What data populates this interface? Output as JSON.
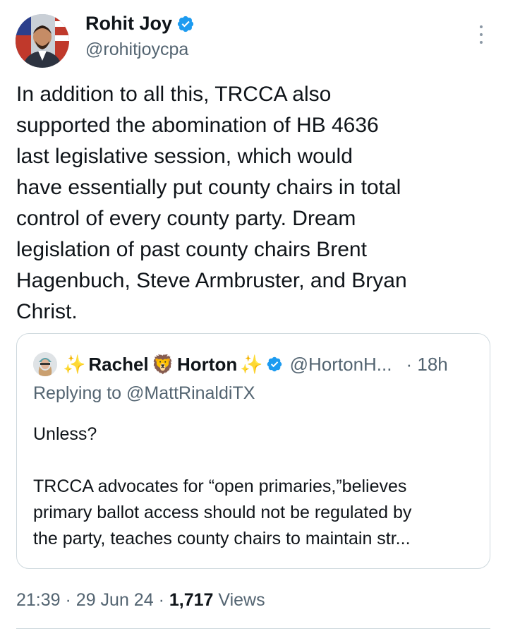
{
  "author": {
    "name": "Rohit Joy",
    "handle": "@rohitjoycpa",
    "avatar_icon": "profile-photo",
    "verified_icon": "verified-badge-icon",
    "verified_color": "#1d9bf0"
  },
  "tweet": {
    "text": "In addition to all this, TRCCA also\nsupported the abomination of HB 4636\nlast legislative session, which would\nhave essentially put county chairs in total\ncontrol of every county party. Dream\nlegislation of past county chairs Brent\nHagenbuch, Steve Armbruster, and Bryan\nChrist."
  },
  "quote": {
    "name_part1": "Rachel",
    "name_part2": "Horton",
    "sparkle_emoji": "✨",
    "lion_emoji": "🦁",
    "handle": "@HortonH...",
    "time": "· 18h",
    "replying_to": "Replying to @MattRinaldiTX",
    "text": "Unless?\n\nTRCCA advocates for “open primaries,”believes\nprimary ballot access should not be regulated by\nthe party, teaches county chairs to maintain str..."
  },
  "meta": {
    "time": "21:39",
    "date": "29 Jun 24",
    "views_count": "1,717",
    "views_label": "Views"
  }
}
